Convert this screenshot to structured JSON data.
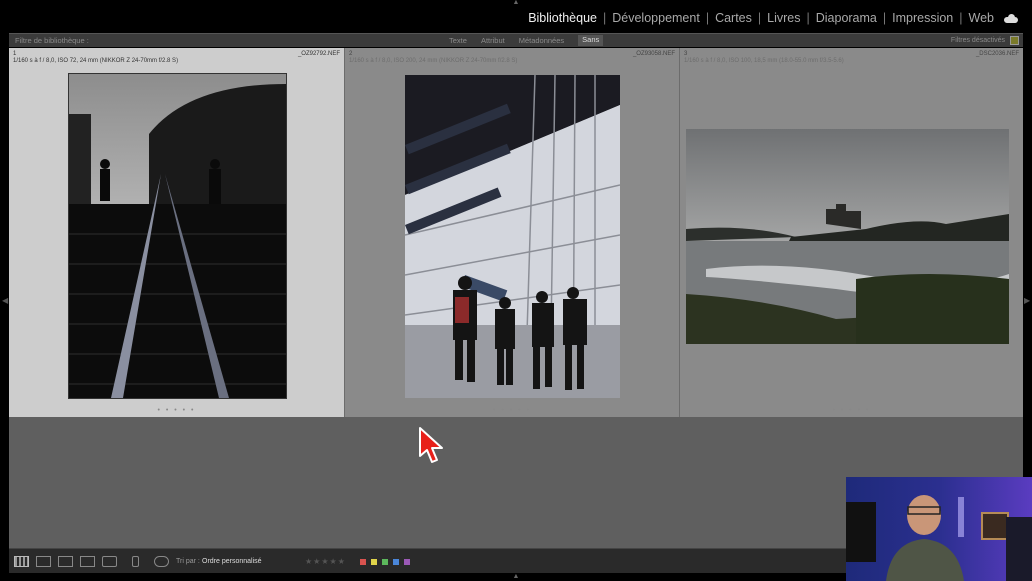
{
  "modules": {
    "items": [
      "Bibliothèque",
      "Développement",
      "Cartes",
      "Livres",
      "Diaporama",
      "Impression",
      "Web"
    ],
    "active": "Bibliothèque",
    "cloud_icon": "cloud-icon"
  },
  "filter_bar": {
    "label": "Filtre de bibliothèque :",
    "tabs": [
      "Texte",
      "Attribut",
      "Métadonnées",
      "Sans"
    ],
    "active_tab": "Sans",
    "status": "Filtres désactivés"
  },
  "grid": {
    "cells": [
      {
        "number": "1",
        "filename": "_OZ92792.NEF",
        "exif": "1/160 s à f / 8,0, ISO 72, 24 mm (NIKKOR Z 24-70mm f/2.8 S)",
        "dots": "• • • • •"
      },
      {
        "number": "2",
        "filename": "_OZ93058.NEF",
        "exif": "1/160 s à f / 8,0, ISO 200, 24 mm (NIKKOR Z 24-70mm f/2.8 S)",
        "dots": "• • • • •"
      },
      {
        "number": "3",
        "filename": "_DSC2036.NEF",
        "exif": "1/160 s à f / 8,0, ISO 100, 18,5 mm (18.0-55.0 mm f/3.5-5.6)",
        "dots": "• • • • •"
      }
    ]
  },
  "toolbar": {
    "sort_label": "Tri par :",
    "sort_value": "Ordre personnalisé",
    "stars": "★★★★★",
    "color_labels": [
      "#d9534f",
      "#e0d34a",
      "#5cb85c",
      "#4a86d9",
      "#9b59b6"
    ]
  },
  "colors": {
    "selected_cell": "#cdcdcd",
    "grid_bg": "#5f5f5f",
    "cursor": "#e8201a"
  }
}
